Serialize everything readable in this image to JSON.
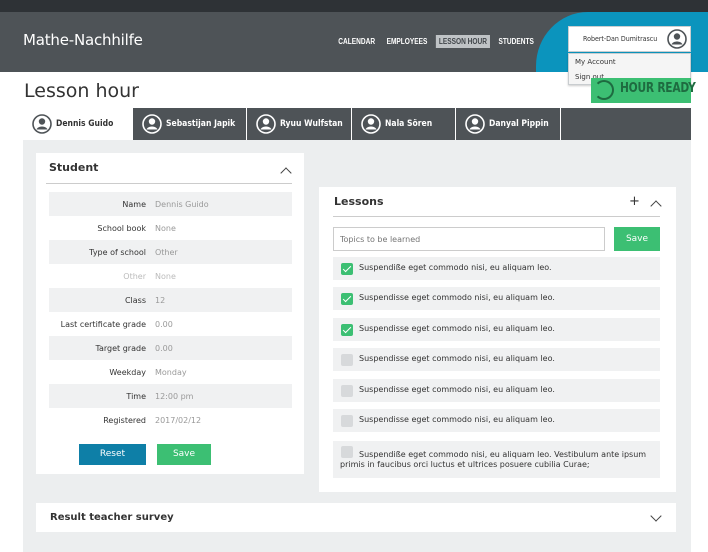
{
  "app": {
    "brand": "Mathe-Nachhilfe",
    "nav": [
      "CALENDAR",
      "EMPLOYEES",
      "LESSON HOUR",
      "STUDENTS"
    ],
    "active_nav": "LESSON HOUR",
    "user": "Robert-Dan Dumitrascu",
    "user_menu": [
      "My Account",
      "Sign out"
    ],
    "ready_button": "HOUR READY"
  },
  "page": {
    "title": "Lesson hour"
  },
  "tabs": [
    "Dennis Guido",
    "Sebastijan Japik",
    "Ryuu Wulfstan",
    "Nala Sören",
    "Danyal Pippin"
  ],
  "student": {
    "heading": "Student",
    "fields": [
      {
        "label": "Name",
        "value": "Dennis Guido"
      },
      {
        "label": "School book",
        "value": "None"
      },
      {
        "label": "Type of school",
        "value": "Other"
      },
      {
        "label": "Other",
        "value": "None"
      },
      {
        "label": "Class",
        "value": "12"
      },
      {
        "label": "Last certificate grade",
        "value": "0.00"
      },
      {
        "label": "Target grade",
        "value": "0.00"
      },
      {
        "label": "Weekday",
        "value": "Monday"
      },
      {
        "label": "Time",
        "value": "12:00 pm"
      },
      {
        "label": "Registered",
        "value": "2017/02/12"
      }
    ],
    "reset_label": "Reset",
    "save_label": "Save"
  },
  "lessons": {
    "heading": "Lessons",
    "add_symbol": "+",
    "input_placeholder": "Topics to be learned",
    "save_label": "Save",
    "items": [
      {
        "text": "Suspendiße eget commodo nisi, eu aliquam leo.",
        "checked": true
      },
      {
        "text": "Suspendisse eget commodo nisi, eu aliquam leo.",
        "checked": true
      },
      {
        "text": "Suspendisse eget commodo nisi, eu aliquam leo.",
        "checked": true
      },
      {
        "text": "Suspendisse eget commodo nisi, eu aliquam leo.",
        "checked": false
      },
      {
        "text": "Suspendisse eget commodo nisi, eu aliquam leo.",
        "checked": false
      },
      {
        "text": "Suspendisse eget commodo nisi, eu aliquam leo.",
        "checked": false
      },
      {
        "text": "Suspendiße eget commodo nisi, eu aliquam leo. Vestibulum ante ipsum primis in faucibus orci luctus et ultrices posuere cubilia Curae;",
        "checked": false
      }
    ]
  },
  "survey": {
    "heading": "Result teacher survey"
  },
  "colors": {
    "header": "#4e5357",
    "accent_teal": "#0b94bd",
    "accent_green": "#3cbf73",
    "reset_blue": "#0e7fa7"
  }
}
